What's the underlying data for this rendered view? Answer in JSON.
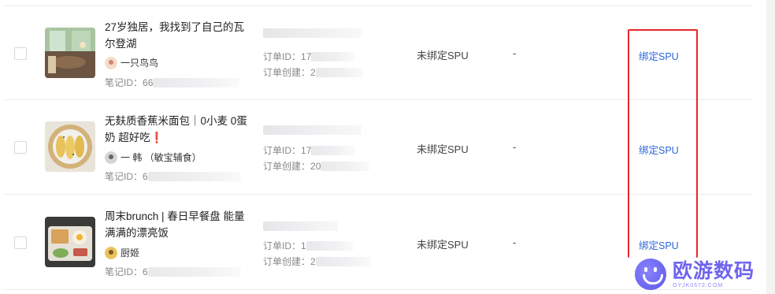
{
  "rows": [
    {
      "title": "27岁独居，我找到了自己的瓦尔登湖",
      "author": "一只鸟鸟",
      "note_prefix": "笔记ID：",
      "note_visible": "66",
      "order_id_label": "订单ID：",
      "order_id_visible": "17",
      "order_created_label": "订单创建：",
      "order_created_visible": "2",
      "status": "未绑定SPU",
      "dash": "-",
      "action": "绑定SPU",
      "thumb_icon": "room-interior-photo"
    },
    {
      "title": "无麸质香蕉米面包｜0小麦 0蛋奶 超好吃❗",
      "author": "一 韩 （敏宝辅食）",
      "note_prefix": "笔记ID：",
      "note_visible": "6",
      "order_id_label": "订单ID：",
      "order_id_visible": "17",
      "order_created_label": "订单创建：",
      "order_created_visible": "20",
      "status": "未绑定SPU",
      "dash": "-",
      "action": "绑定SPU",
      "thumb_icon": "banana-bread-photo"
    },
    {
      "title": "周末brunch | 春日早餐盘 能量满满的漂亮饭",
      "author": "厨姬",
      "note_prefix": "笔记ID：",
      "note_visible": "6",
      "order_id_label": "订单ID：",
      "order_id_visible": "1",
      "order_created_label": "订单创建：",
      "order_created_visible": "2",
      "status": "未绑定SPU",
      "dash": "-",
      "action": "绑定SPU",
      "thumb_icon": "brunch-plate-photo"
    }
  ],
  "watermark": {
    "text": "欧游数码",
    "url": "OYJK0572.COM"
  },
  "colors": {
    "link": "#2b66d9",
    "highlight_box": "#e8262a",
    "watermark": "#6e64ee"
  }
}
